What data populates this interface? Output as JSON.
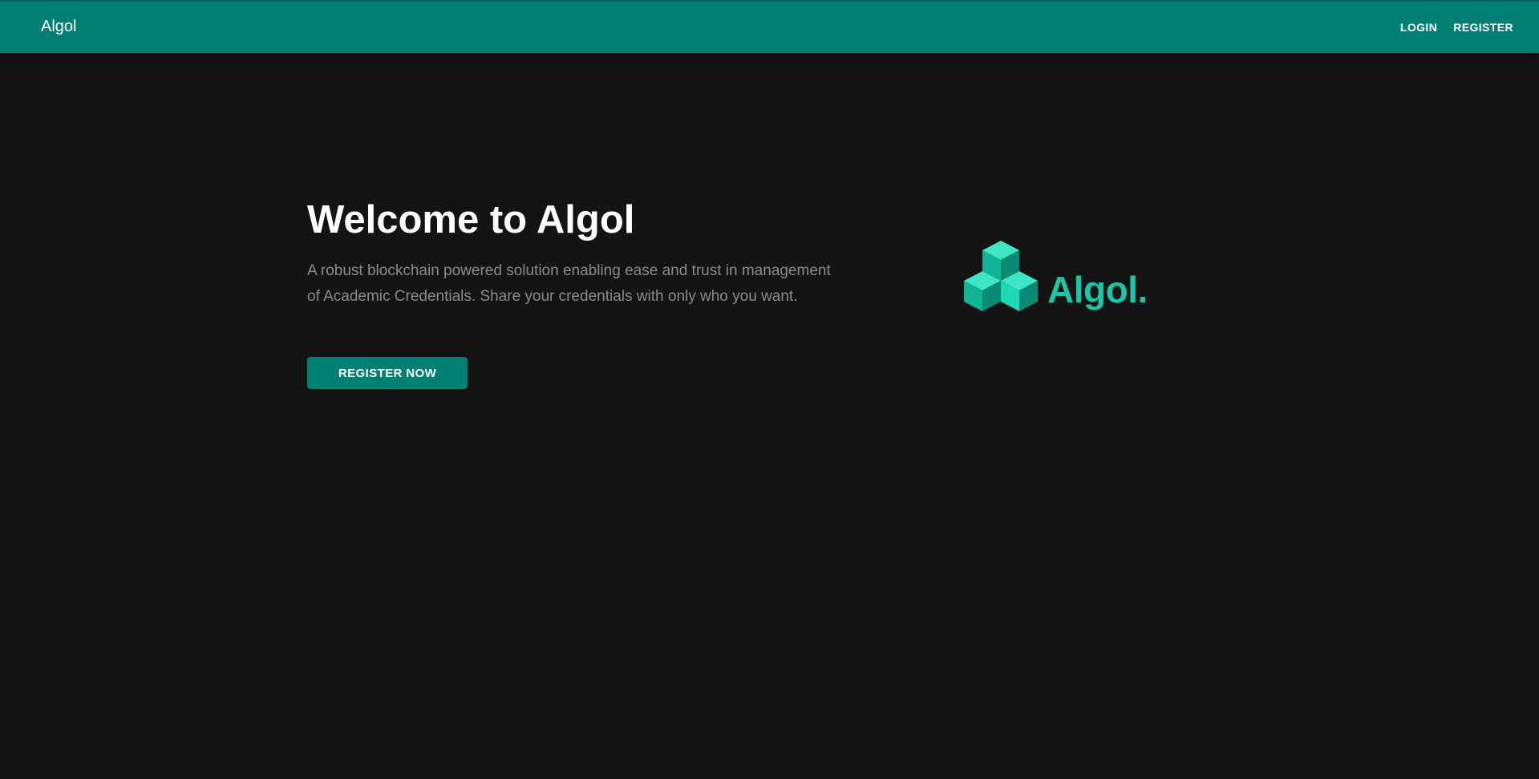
{
  "header": {
    "brand": "Algol",
    "nav": {
      "login_label": "LOGIN",
      "register_label": "REGISTER"
    }
  },
  "hero": {
    "title": "Welcome to Algol",
    "description": "A robust blockchain powered solution enabling ease and trust in management of Academic Credentials. Share your credentials with only who you want.",
    "cta_label": "REGISTER NOW"
  },
  "logo": {
    "text": "Algol.",
    "icon": "stacked-cubes-icon"
  },
  "colors": {
    "appbar": "#008074",
    "background": "#141414",
    "accent": "#1dc4a8",
    "muted_text": "#8a8a8a"
  }
}
